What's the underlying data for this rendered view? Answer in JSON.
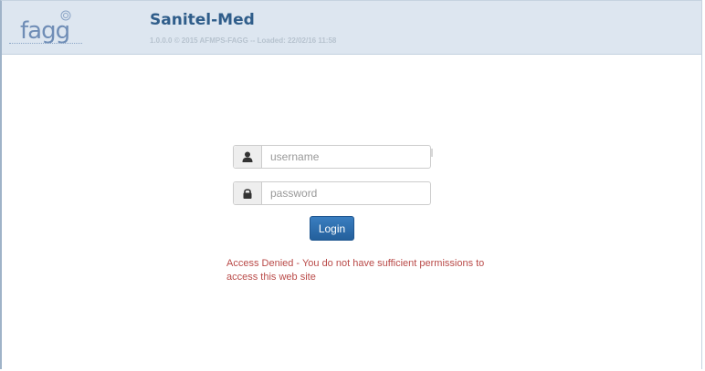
{
  "header": {
    "logo_text": "fagg",
    "title": "Sanitel-Med",
    "meta": "1.0.0.0 © 2015 AFMPS-FAGG -- Loaded: 22/02/16 11:58"
  },
  "login": {
    "username_placeholder": "username",
    "password_placeholder": "password",
    "button_label": "Login",
    "error_message": "Access Denied - You do not have sufficient permissions to access this web site"
  },
  "icons": {
    "username": "user-icon",
    "password": "lock-icon"
  },
  "colors": {
    "header_bg": "#dde6f0",
    "title": "#2f5d8a",
    "button": "#2b6cb0",
    "error": "#b94a48"
  }
}
